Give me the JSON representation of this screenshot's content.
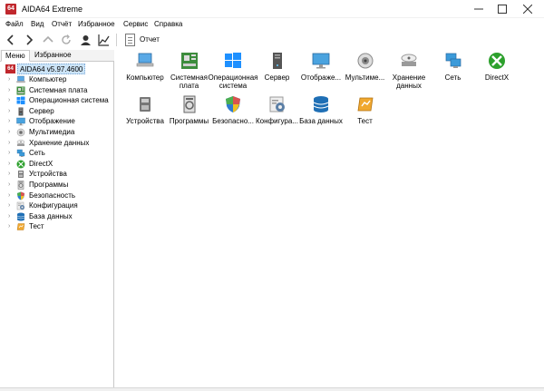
{
  "window": {
    "logo_text": "64",
    "title": "AIDA64 Extreme"
  },
  "menu": [
    "Файл",
    "Вид",
    "Отчёт",
    "Избранное",
    "Сервис",
    "Справка"
  ],
  "toolbar": {
    "report_label": "Отчет"
  },
  "tabs": [
    "Меню",
    "Избранное"
  ],
  "tree": {
    "root": "AIDA64 v5.97.4600",
    "items": [
      {
        "label": "Компьютер",
        "icon": "computer-icon",
        "color": "#5aa9e6"
      },
      {
        "label": "Системная плата",
        "icon": "motherboard-icon",
        "color": "#3d8c3d"
      },
      {
        "label": "Операционная система",
        "icon": "windows-icon",
        "color": "#1e90ff"
      },
      {
        "label": "Сервер",
        "icon": "server-icon",
        "color": "#555555"
      },
      {
        "label": "Отображение",
        "icon": "monitor-icon",
        "color": "#4aa3df"
      },
      {
        "label": "Мультимедиа",
        "icon": "speaker-icon",
        "color": "#8a8a8a"
      },
      {
        "label": "Хранение данных",
        "icon": "storage-icon",
        "color": "#9a9a9a"
      },
      {
        "label": "Сеть",
        "icon": "network-icon",
        "color": "#3b9ad9"
      },
      {
        "label": "DirectX",
        "icon": "directx-icon",
        "color": "#2ca02c"
      },
      {
        "label": "Устройства",
        "icon": "devices-icon",
        "color": "#777777"
      },
      {
        "label": "Программы",
        "icon": "programs-icon",
        "color": "#666666"
      },
      {
        "label": "Безопасность",
        "icon": "shield-icon",
        "color": "#d9534f"
      },
      {
        "label": "Конфигурация",
        "icon": "config-icon",
        "color": "#5b7fa6"
      },
      {
        "label": "База данных",
        "icon": "database-icon",
        "color": "#1f6fb5"
      },
      {
        "label": "Тест",
        "icon": "benchmark-icon",
        "color": "#f0a830"
      }
    ]
  },
  "grid": [
    {
      "label": "Компьютер",
      "icon": "computer-icon",
      "color": "#5aa9e6"
    },
    {
      "label": "Системная плата",
      "icon": "motherboard-icon",
      "color": "#3d8c3d"
    },
    {
      "label": "Операционная система",
      "icon": "windows-icon",
      "color": "#1e90ff"
    },
    {
      "label": "Сервер",
      "icon": "server-icon",
      "color": "#555555"
    },
    {
      "label": "Отображе...",
      "icon": "monitor-icon",
      "color": "#4aa3df"
    },
    {
      "label": "Мультиме...",
      "icon": "speaker-icon",
      "color": "#8a8a8a"
    },
    {
      "label": "Хранение данных",
      "icon": "storage-icon",
      "color": "#9a9a9a"
    },
    {
      "label": "Сеть",
      "icon": "network-icon",
      "color": "#3b9ad9"
    },
    {
      "label": "DirectX",
      "icon": "directx-icon",
      "color": "#2ca02c"
    },
    {
      "label": "Устройства",
      "icon": "devices-icon",
      "color": "#777777"
    },
    {
      "label": "Программы",
      "icon": "programs-icon",
      "color": "#666666"
    },
    {
      "label": "Безопасно...",
      "icon": "shield-icon",
      "color": "#d9534f"
    },
    {
      "label": "Конфигура...",
      "icon": "config-icon",
      "color": "#5b7fa6"
    },
    {
      "label": "База данных",
      "icon": "database-icon",
      "color": "#1f6fb5"
    },
    {
      "label": "Тест",
      "icon": "benchmark-icon",
      "color": "#f0a830"
    }
  ]
}
